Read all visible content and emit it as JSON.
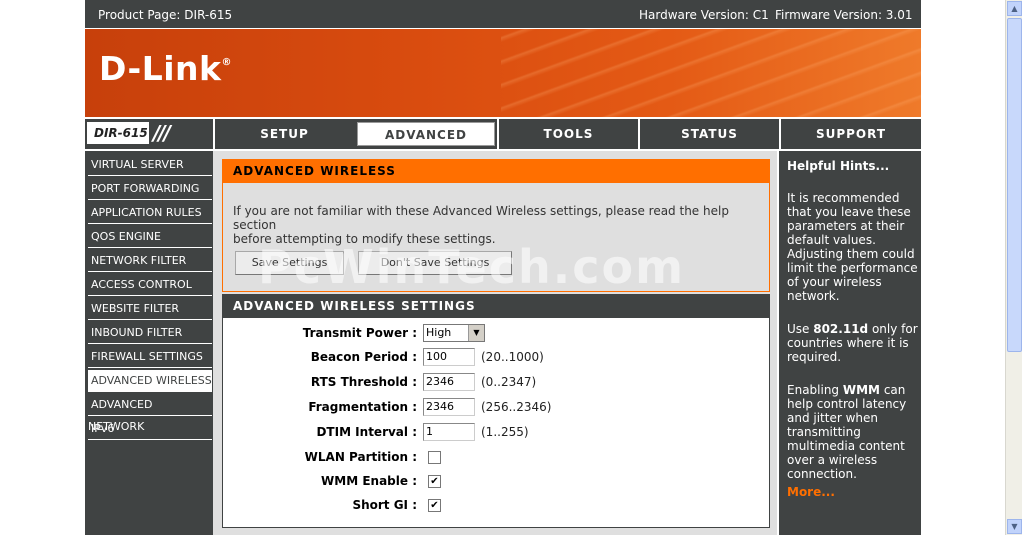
{
  "topbar": {
    "product": "Product Page: DIR-615",
    "hardware": "Hardware Version: C1",
    "firmware": "Firmware Version: 3.01"
  },
  "banner": {
    "logo": "D-Link"
  },
  "nav": {
    "model": "DIR-615",
    "tabs": [
      "SETUP",
      "ADVANCED",
      "TOOLS",
      "STATUS",
      "SUPPORT"
    ],
    "active_tab": "ADVANCED"
  },
  "sidebar": {
    "items": [
      "VIRTUAL SERVER",
      "PORT FORWARDING",
      "APPLICATION RULES",
      "QOS ENGINE",
      "NETWORK FILTER",
      "ACCESS CONTROL",
      "WEBSITE FILTER",
      "INBOUND FILTER",
      "FIREWALL SETTINGS",
      "ADVANCED WIRELESS",
      "ADVANCED NETWORK",
      "IPv6"
    ],
    "active_item": "ADVANCED WIRELESS"
  },
  "advanced_wireless": {
    "title": "ADVANCED WIRELESS",
    "message_line1": "If you are not familiar with these Advanced Wireless settings, please read the help section",
    "message_line2": "before attempting to modify these settings.",
    "save_label": "Save Settings",
    "dont_save_label": "Don't Save Settings"
  },
  "settings": {
    "title": "ADVANCED WIRELESS SETTINGS",
    "transmit_power": {
      "label": "Transmit Power :",
      "value": "High"
    },
    "beacon_period": {
      "label": "Beacon Period :",
      "value": "100",
      "range": "(20..1000)"
    },
    "rts_threshold": {
      "label": "RTS Threshold :",
      "value": "2346",
      "range": "(0..2347)"
    },
    "fragmentation": {
      "label": "Fragmentation :",
      "value": "2346",
      "range": "(256..2346)"
    },
    "dtim_interval": {
      "label": "DTIM Interval :",
      "value": "1",
      "range": "(1..255)"
    },
    "wlan_partition": {
      "label": "WLAN Partition :",
      "checked": false
    },
    "wmm_enable": {
      "label": "WMM Enable :",
      "checked": true
    },
    "short_gi": {
      "label": "Short GI :",
      "checked": true
    }
  },
  "hints": {
    "title": "Helpful Hints...",
    "p1": "It is recommended that you leave these parameters at their default values. Adjusting them could limit the performance of your wireless network.",
    "p2_pre": "Use ",
    "p2_bold": "802.11d",
    "p2_post": " only for countries where it is required.",
    "p3_pre": "Enabling ",
    "p3_bold": "WMM",
    "p3_post": " can help control latency and jitter when transmitting multimedia content over a wireless connection.",
    "more": "More..."
  },
  "watermark": "PcWinTech.com",
  "colors": {
    "accent": "#ff6f00",
    "dark": "#404343"
  }
}
